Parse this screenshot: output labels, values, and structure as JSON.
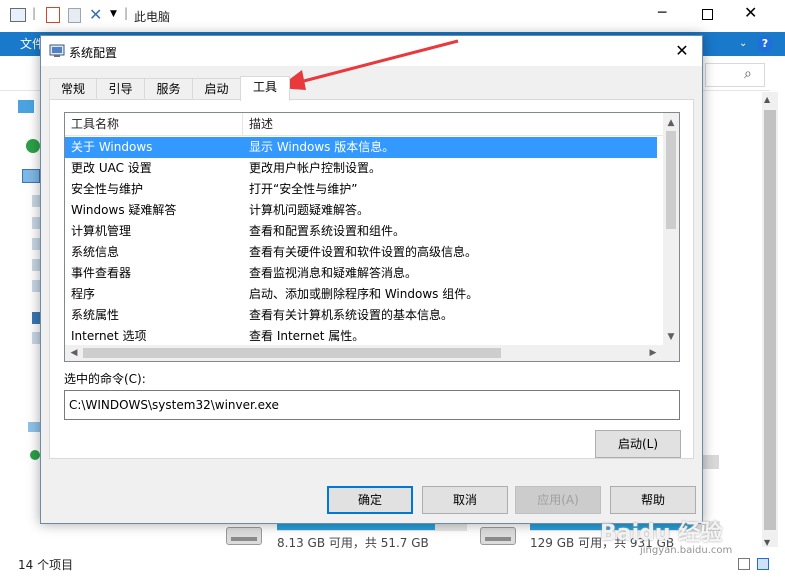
{
  "explorer": {
    "title": "此电脑",
    "file_tab": "文件",
    "status_items": "14 个项目",
    "drives": [
      {
        "info": "8.13 GB 可用，共 51.7 GB"
      },
      {
        "info": "129 GB 可用，共 931 GB"
      }
    ]
  },
  "dialog": {
    "title": "系统配置",
    "tabs": [
      "常规",
      "引导",
      "服务",
      "启动",
      "工具"
    ],
    "active_tab": "工具",
    "columns": {
      "name": "工具名称",
      "desc": "描述"
    },
    "tools": [
      {
        "name": "关于 Windows",
        "desc": "显示 Windows 版本信息。"
      },
      {
        "name": "更改 UAC 设置",
        "desc": "更改用户帐户控制设置。"
      },
      {
        "name": "安全性与维护",
        "desc": "打开“安全性与维护”"
      },
      {
        "name": "Windows 疑难解答",
        "desc": "计算机问题疑难解答。"
      },
      {
        "name": "计算机管理",
        "desc": "查看和配置系统设置和组件。"
      },
      {
        "name": "系统信息",
        "desc": "查看有关硬件设置和软件设置的高级信息。"
      },
      {
        "name": "事件查看器",
        "desc": "查看监视消息和疑难解答消息。"
      },
      {
        "name": "程序",
        "desc": "启动、添加或删除程序和 Windows 组件。"
      },
      {
        "name": "系统属性",
        "desc": "查看有关计算机系统设置的基本信息。"
      },
      {
        "name": "Internet 选项",
        "desc": "查看 Internet 属性。"
      }
    ],
    "selected_row": 0,
    "command_label": "选中的命令(C):",
    "command_value": "C:\\WINDOWS\\system32\\winver.exe",
    "launch_label": "启动(L)",
    "buttons": {
      "ok": "确定",
      "cancel": "取消",
      "apply": "应用(A)",
      "help": "帮助"
    },
    "close_glyph": "✕"
  },
  "watermark": {
    "brand": "Baidu 经验",
    "url": "jingyan.baidu.com"
  },
  "colors": {
    "selection": "#3399ff",
    "ribbon": "#1979ca",
    "annotation_arrow": "#e8393d"
  }
}
